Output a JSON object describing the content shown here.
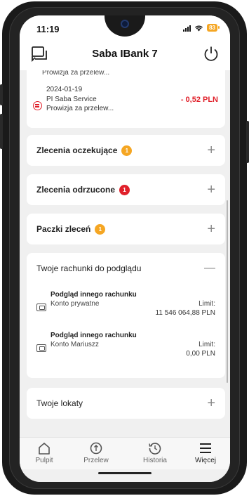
{
  "status_bar": {
    "time": "11:19",
    "battery": "83"
  },
  "app_bar": {
    "title": "Saba IBank 7",
    "left_icon": "chat-icon",
    "right_icon": "power-icon"
  },
  "transactions": [
    {
      "desc_cut": "Prowizja za przelew...",
      "date": "",
      "name": "",
      "amount": ""
    },
    {
      "date": "2024-01-19",
      "name": "PI Saba Service",
      "desc": "Prowizja za przelew...",
      "amount": "- 0,52 PLN",
      "icon": "transfer-out-icon"
    }
  ],
  "sections": {
    "pending": {
      "label": "Zlecenia oczekujące",
      "badge": "1",
      "badge_color": "#f5a623",
      "toggle": "+"
    },
    "rejected": {
      "label": "Zlecenia odrzucone",
      "badge": "1",
      "badge_color": "#e0202a",
      "toggle": "+"
    },
    "packages": {
      "label": "Paczki zleceń",
      "badge": "1",
      "badge_color": "#f5a623",
      "toggle": "+"
    },
    "watched_accounts": {
      "label": "Twoje rachunki do podglądu",
      "toggle": "—",
      "accounts": [
        {
          "title": "Podgląd innego rachunku",
          "subtitle": "Konto prywatne",
          "limit_label": "Limit:",
          "limit_value": "11 546 064,88 PLN",
          "icon": "wallet-icon"
        },
        {
          "title": "Podgląd innego rachunku",
          "subtitle": "Konto Mariuszz",
          "limit_label": "Limit:",
          "limit_value": "0,00 PLN",
          "icon": "wallet-icon"
        }
      ]
    },
    "deposits": {
      "label": "Twoje lokaty",
      "toggle": "+"
    }
  },
  "bottom_nav": [
    {
      "label": "Pulpit",
      "icon": "home-icon"
    },
    {
      "label": "Przelew",
      "icon": "transfer-icon"
    },
    {
      "label": "Historia",
      "icon": "history-icon"
    },
    {
      "label": "Więcej",
      "icon": "menu-icon"
    }
  ],
  "colors": {
    "accent_red": "#e0202a",
    "badge_orange": "#f5a623",
    "background": "#f0f0f0"
  }
}
